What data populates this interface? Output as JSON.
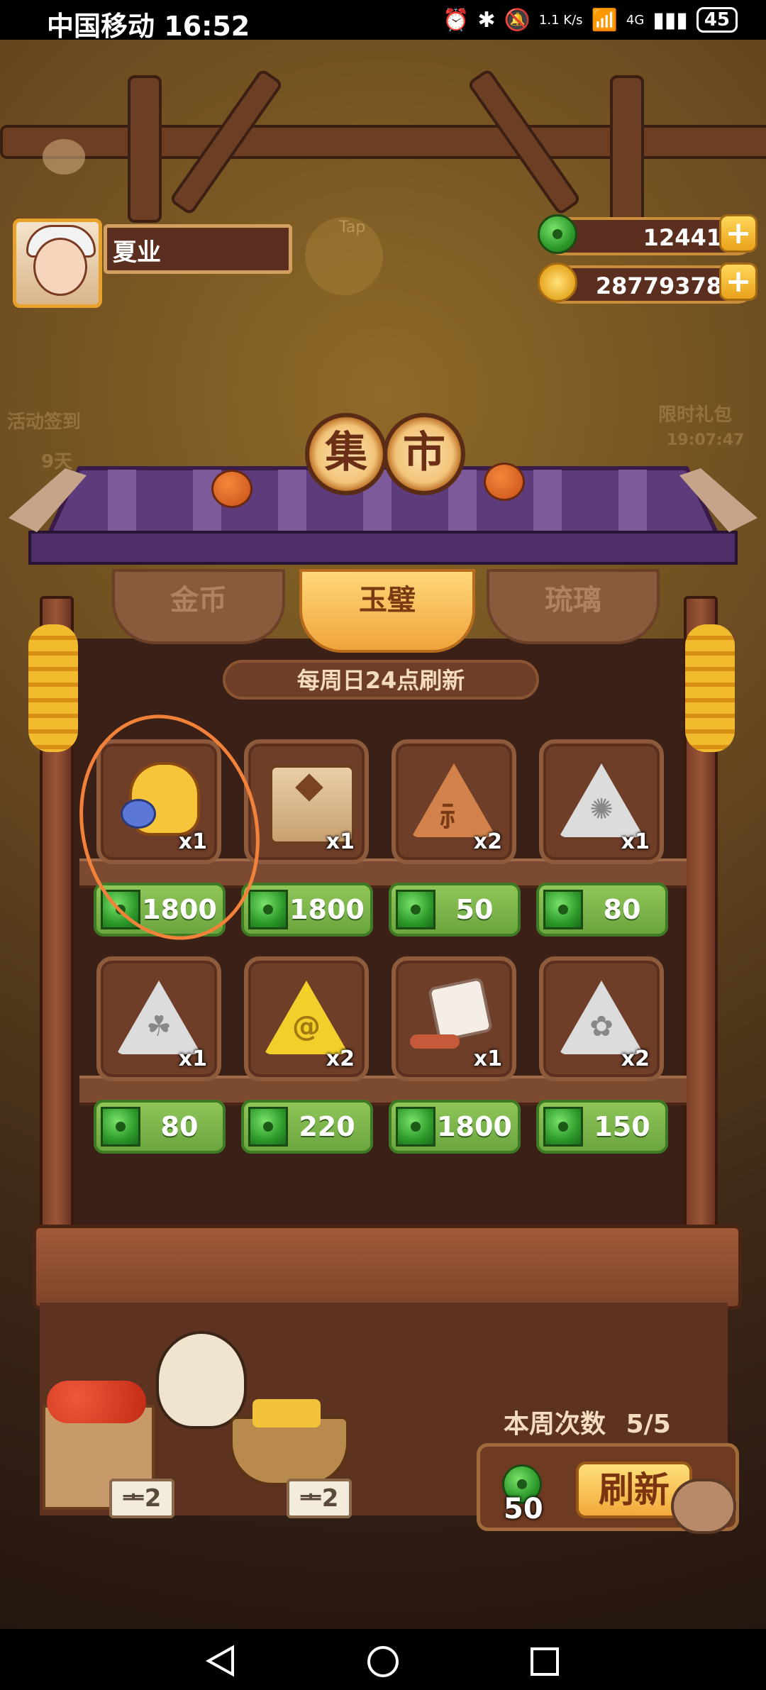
{
  "status_bar": {
    "carrier": "中国移动",
    "time": "16:52",
    "speed": "1.1 K/s",
    "network": "4G",
    "battery": "45"
  },
  "player": {
    "name": "夏业"
  },
  "currencies": {
    "jade": "12441",
    "gold": "28779378"
  },
  "side_events": {
    "left_label": "活动签到",
    "left_days": "9天",
    "right_label": "限时礼包",
    "right_timer": "19:07:47"
  },
  "tap_hint": "Tap",
  "title": [
    "集",
    "市"
  ],
  "tabs": [
    {
      "label": "金币",
      "active": false
    },
    {
      "label": "玉璧",
      "active": true
    },
    {
      "label": "琉璃",
      "active": false
    }
  ],
  "refresh_note": "每周日24点刷新",
  "items": [
    {
      "icon": "cat-pet-icon",
      "qty": "x1",
      "price": "1800"
    },
    {
      "icon": "treasure-chest-icon",
      "qty": "x1",
      "price": "1800"
    },
    {
      "icon": "bronze-rune-stone-icon",
      "qty": "x2",
      "price": "50"
    },
    {
      "icon": "silver-bug-rune-stone-icon",
      "qty": "x1",
      "price": "80"
    },
    {
      "icon": "silver-leaf-rune-stone-icon",
      "qty": "x1",
      "price": "80"
    },
    {
      "icon": "gold-spiral-rune-stone-icon",
      "qty": "x2",
      "price": "220"
    },
    {
      "icon": "dice-cube-icon",
      "qty": "x1",
      "price": "1800"
    },
    {
      "icon": "silver-flower-rune-stone-icon",
      "qty": "x2",
      "price": "150"
    }
  ],
  "weekly": {
    "label": "本周次数",
    "count": "5/5"
  },
  "refresh_button": {
    "label": "刷新",
    "cost": "50"
  },
  "stall_tags": [
    "ᆂ2",
    "ᆂ2"
  ],
  "colors": {
    "jade": "#3ea632",
    "gold": "#f2b43a",
    "wood": "#6e3e28",
    "price_bg": "#7cb64c"
  }
}
